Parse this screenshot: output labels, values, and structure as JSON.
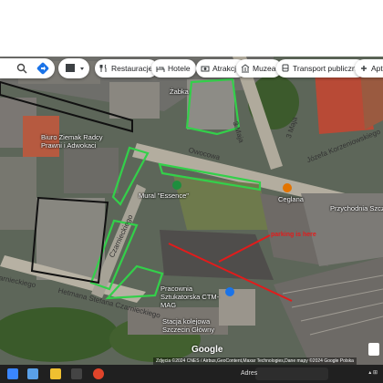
{
  "toolbar": {
    "search_icon": "search-icon",
    "directions_icon": "directions-icon",
    "layers_icon": "layers-icon",
    "chips": [
      {
        "label": "Restauracje",
        "icon": "fork-knife-icon"
      },
      {
        "label": "Hotele",
        "icon": "bed-icon"
      },
      {
        "label": "Atrakcje",
        "icon": "camera-icon"
      },
      {
        "label": "Muzea",
        "icon": "museum-icon"
      },
      {
        "label": "Transport publiczny",
        "icon": "bus-icon"
      },
      {
        "label": "Aptek",
        "icon": "pharmacy-icon"
      }
    ]
  },
  "map": {
    "places": {
      "zabka": "Żabka",
      "biuro": "Biuro Ziemak Radcy Prawni i Adwokaci",
      "mural": "Mural \"Essence\"",
      "ceglana": "Ceglana",
      "pracownia": "Pracownia Sztukatorska CTM-MAG",
      "stacja": "Stacja kolejowa Szczecin Główny",
      "przychodnia": "Przychodnia Szczec..."
    },
    "streets": {
      "owocowa": "Owocowa",
      "hetmana": "Hetmana Stefana Czarnieckiego",
      "czarnieckiego_left": "arnieckiego",
      "czarnieckiego_vert": "Czarnieckiego",
      "trzeciego_maja_a": "3 Maja",
      "trzeciego_maja_b": "3 Maja",
      "korzeniowskiego": "Józefa Korzeniowskiego"
    },
    "annotation": "parking is here",
    "attribution": "Zdjęcia ©2024 CNES / Airbus,GeoContent,Maxar Technologies,Dane mapy ©2024 Google",
    "attribution_extra": "Polska",
    "google": "Google"
  },
  "taskbar": {
    "search_label": "Adres",
    "search_value": ""
  },
  "colors": {
    "highlight_green": "#33d04a",
    "annotation_red": "#e31b1b",
    "pin_green": "#1e8e3e",
    "pin_orange": "#e37400"
  }
}
